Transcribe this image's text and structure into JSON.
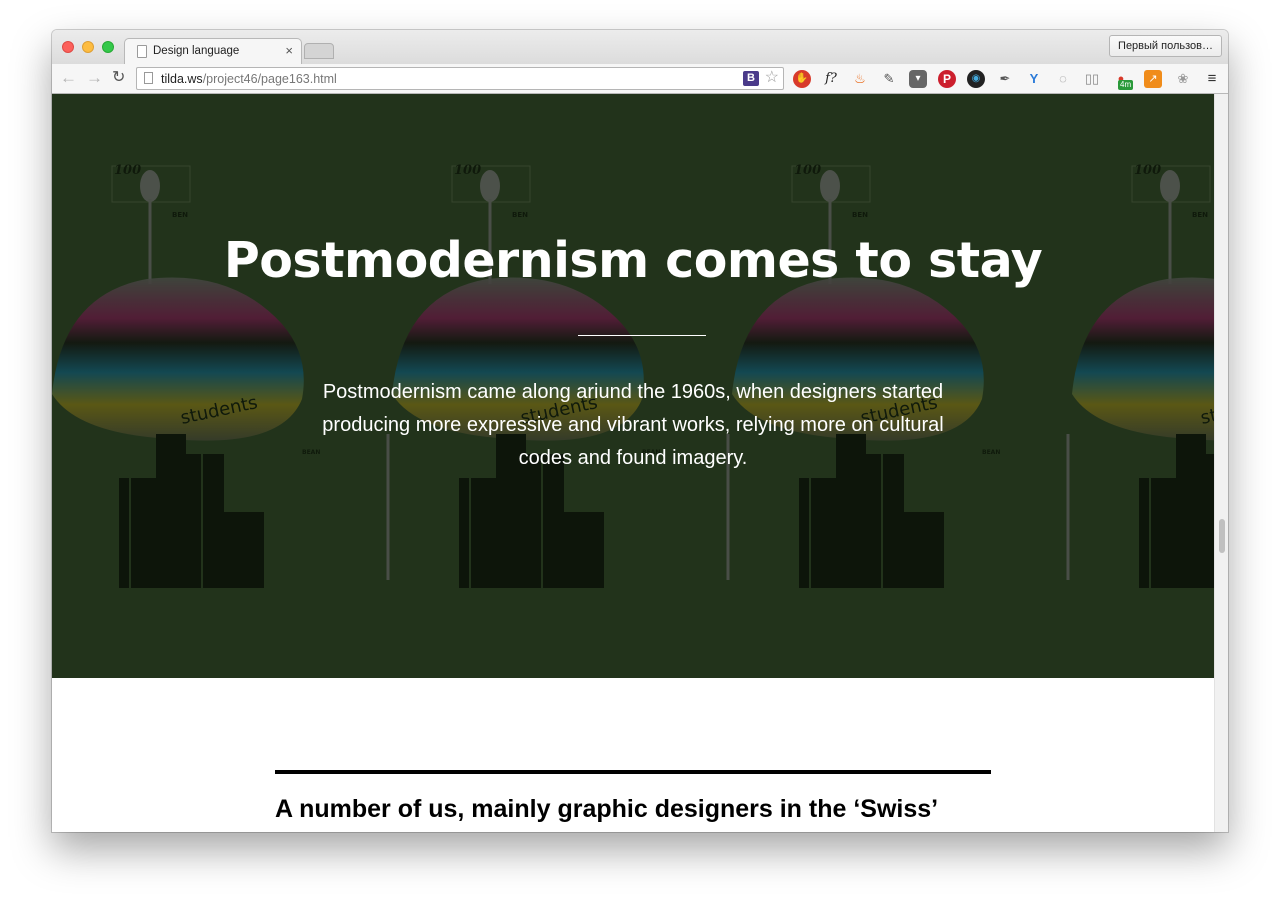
{
  "browser": {
    "tab_title": "Design language",
    "tab_close": "×",
    "profile_label": "Первый пользов…",
    "url_domain": "tilda.ws",
    "url_path": "/project46/page163.html",
    "bookmark_label": "B",
    "nav": {
      "back": "←",
      "forward": "→",
      "reload": "↻"
    },
    "extensions": [
      "adblock-icon",
      "whatfont-icon",
      "fire-icon",
      "evernote-icon",
      "pocket-icon",
      "pinterest-icon",
      "camera-icon",
      "eyedropper-icon",
      "yandex-icon",
      "refresh-ext-icon",
      "reader-icon",
      "chart-ext-icon",
      "analytics-icon",
      "paw-icon",
      "menu-icon"
    ],
    "ext_badge": "4m"
  },
  "hero": {
    "title": "Postmodernism comes to stay",
    "text": "Postmodernism came along ariund the 1960s, when designers started producing more expressive and vibrant works, relying more on cultural codes and found imagery.",
    "poster_numbers": [
      "100",
      "100",
      "100",
      "100"
    ],
    "poster_words": [
      "students"
    ],
    "poster_label": "BEN"
  },
  "article": {
    "heading": "A number of us, mainly graphic designers in the ‘Swiss’"
  },
  "colors": {
    "hero_bg": "#2a3d22",
    "accent_magenta": "#c0187a",
    "accent_cyan": "#1a8aa8",
    "accent_yellow": "#c8b020"
  }
}
